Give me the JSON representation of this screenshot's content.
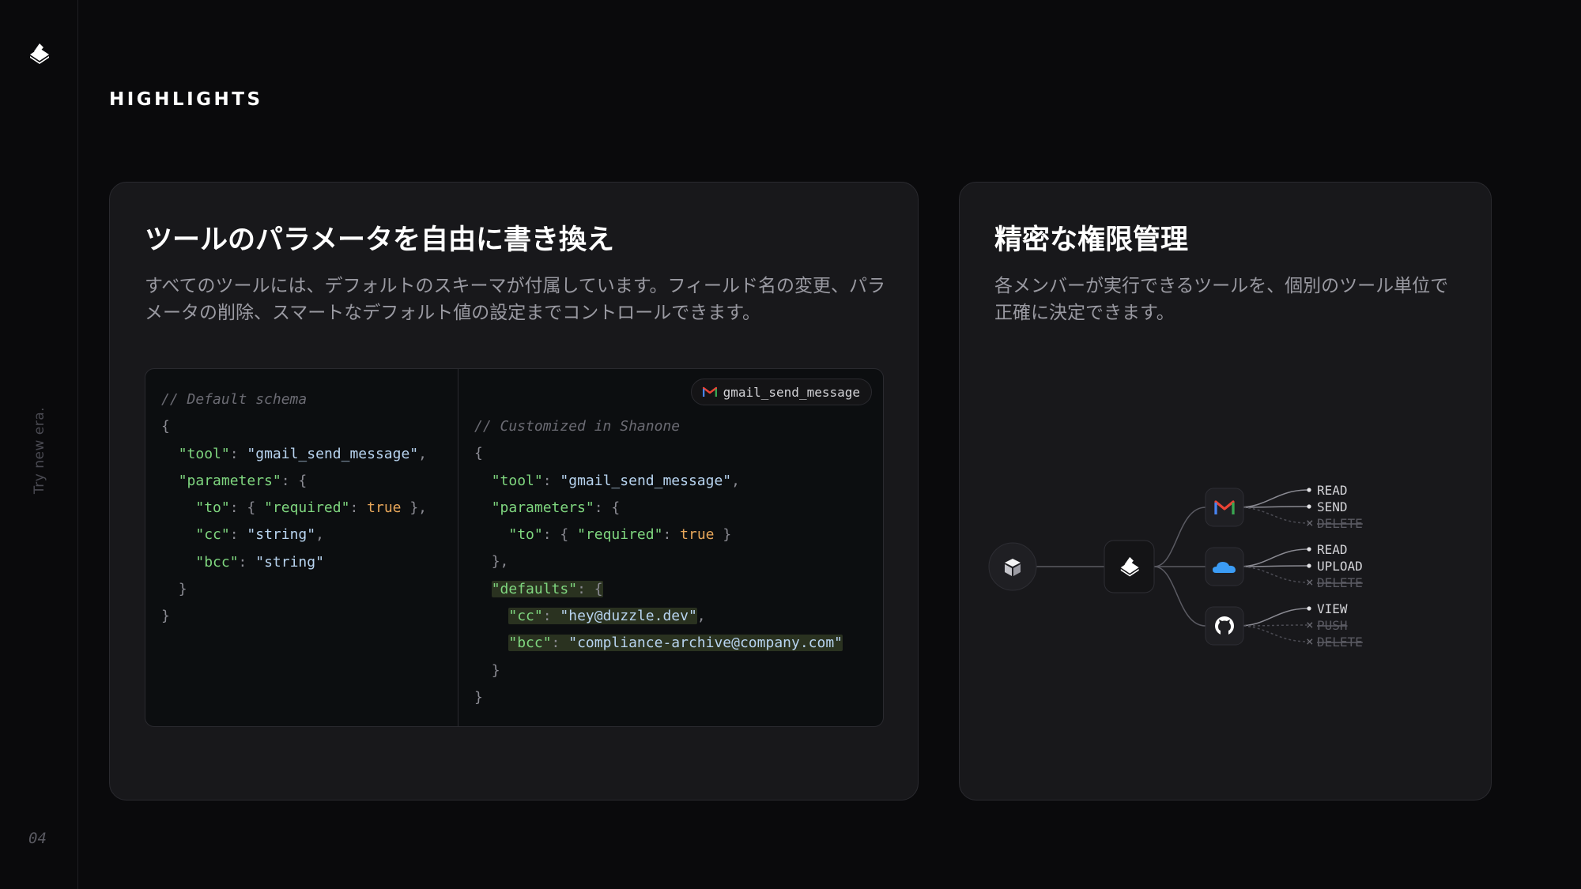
{
  "sidebar": {
    "tagline": "Try new era.",
    "page_number": "04"
  },
  "section_label": "HIGHLIGHTS",
  "left_card": {
    "title": "ツールのパラメータを自由に書き換え",
    "description": "すべてのツールには、デフォルトのスキーマが付属しています。フィールド名の変更、パラメータの削除、スマートなデフォルト値の設定までコントロールできます。",
    "default_comment": "// Default schema",
    "custom_comment": "// Customized in Shanone",
    "tool_badge": "gmail_send_message",
    "default_code": [
      "{",
      "  \"tool\": \"gmail_send_message\",",
      "  \"parameters\": {",
      "    \"to\": { \"required\": true },",
      "    \"cc\": \"string\",",
      "    \"bcc\": \"string\"",
      "  }",
      "}"
    ],
    "custom_code": [
      "{",
      "  \"tool\": \"gmail_send_message\",",
      "  \"parameters\": {",
      "    \"to\": { \"required\": true }",
      "  },",
      "  \"defaults\": {",
      "    \"cc\": \"hey@duzzle.dev\",",
      "    \"bcc\": \"compliance-archive@company.com\"",
      "  }",
      "}"
    ]
  },
  "right_card": {
    "title": "精密な権限管理",
    "description": "各メンバーが実行できるツールを、個別のツール単位で正確に決定できます。",
    "apps": [
      {
        "icon": "gmail-icon",
        "permissions": [
          {
            "label": "READ",
            "allowed": true
          },
          {
            "label": "SEND",
            "allowed": true
          },
          {
            "label": "DELETE",
            "allowed": false
          }
        ]
      },
      {
        "icon": "cloud-icon",
        "permissions": [
          {
            "label": "READ",
            "allowed": true
          },
          {
            "label": "UPLOAD",
            "allowed": true
          },
          {
            "label": "DELETE",
            "allowed": false
          }
        ]
      },
      {
        "icon": "github-icon",
        "permissions": [
          {
            "label": "VIEW",
            "allowed": true
          },
          {
            "label": "PUSH",
            "allowed": false
          },
          {
            "label": "DELETE",
            "allowed": false
          }
        ]
      }
    ]
  },
  "colors": {
    "background": "#0a0a0c",
    "card": "#18181b",
    "key": "#7fd67f",
    "string": "#b8d4f0",
    "boolean": "#e8a75a",
    "highlight": "#2a3220"
  }
}
